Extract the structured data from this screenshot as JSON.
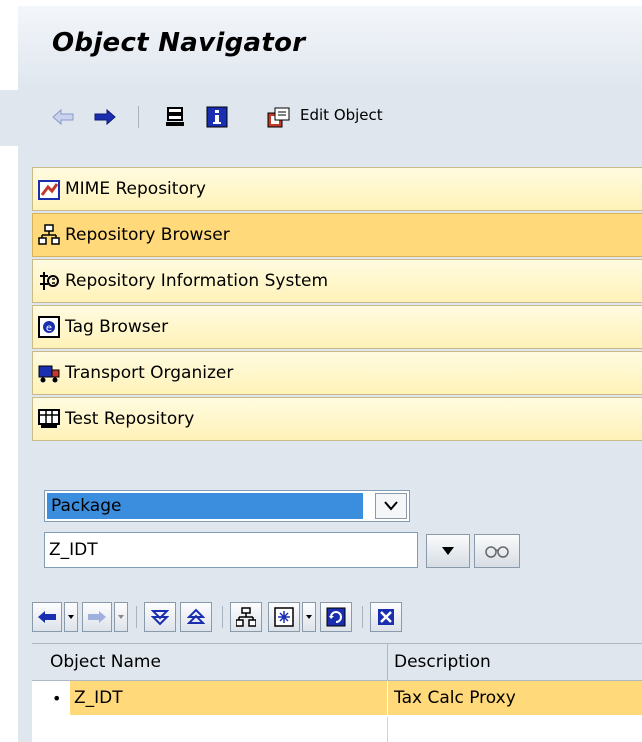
{
  "window": {
    "title": "Object Navigator"
  },
  "toolbar": {
    "edit_object_label": "Edit Object"
  },
  "navigator": {
    "items": [
      {
        "label": "MIME Repository",
        "icon": "mime-repository-icon",
        "selected": false
      },
      {
        "label": "Repository Browser",
        "icon": "repository-browser-icon",
        "selected": true
      },
      {
        "label": "Repository Information System",
        "icon": "repository-info-system-icon",
        "selected": false
      },
      {
        "label": "Tag Browser",
        "icon": "tag-browser-icon",
        "selected": false
      },
      {
        "label": "Transport Organizer",
        "icon": "transport-organizer-icon",
        "selected": false
      },
      {
        "label": "Test Repository",
        "icon": "test-repository-icon",
        "selected": false
      }
    ]
  },
  "object_selector": {
    "type_value": "Package",
    "name_value": "Z_IDT"
  },
  "tree": {
    "columns": [
      "Object Name",
      "Description"
    ],
    "rows": [
      {
        "bullet": "•",
        "name": "Z_IDT",
        "description": "Tax Calc Proxy"
      }
    ]
  },
  "colors": {
    "background": "#dfe6ee",
    "nav_item": "#fff2b8",
    "nav_selected": "#ffd97a",
    "dropdown_highlight": "#3b8dde",
    "row_selected": "#ffd97a"
  }
}
